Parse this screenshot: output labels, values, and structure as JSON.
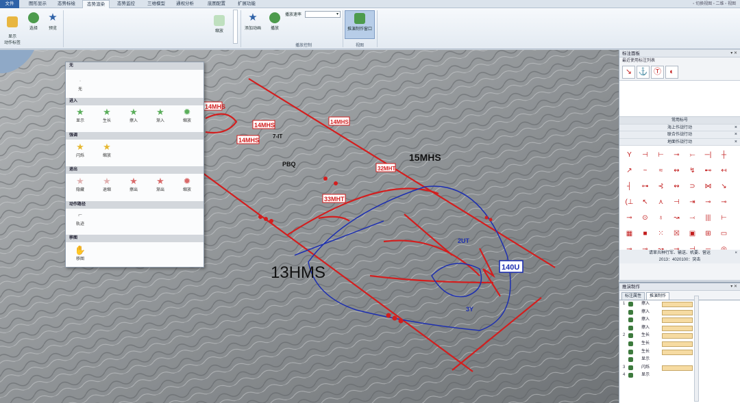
{
  "menubar": {
    "tabs": [
      {
        "label": "文件",
        "state": "file"
      },
      {
        "label": "图形显示",
        "state": ""
      },
      {
        "label": "态势标绘",
        "state": ""
      },
      {
        "label": "态势渲染",
        "state": "active"
      },
      {
        "label": "态势监控",
        "state": ""
      },
      {
        "label": "三维模型",
        "state": ""
      },
      {
        "label": "通视分析",
        "state": ""
      },
      {
        "label": "底图配置",
        "state": ""
      },
      {
        "label": "扩展功能",
        "state": ""
      }
    ],
    "window_controls": "▫ 切换视图 ▫ 二维 ▫ 视图"
  },
  "ribbon": {
    "show_label": "显示\n动作标签",
    "select": "选择",
    "preview": "预览",
    "zoom": "缩放",
    "add_anim": "添加动画",
    "play": "播放",
    "speed_label": "播放速率",
    "speed_value": "",
    "play_group": "播放控制",
    "make_window": "推演制作窗口",
    "view_group": "视图"
  },
  "dropdown": {
    "none_head": "无",
    "none_item": "无",
    "enter_head": "进入",
    "enter_items": [
      "显示",
      "生长",
      "擦入",
      "渐入",
      "缩放"
    ],
    "emph_head": "强调",
    "emph_items": [
      "闪烁",
      "缩放"
    ],
    "exit_head": "退出",
    "exit_items": [
      "隐藏",
      "退缩",
      "擦出",
      "渐出",
      "缩放"
    ],
    "path_head": "动作路径",
    "path_item": "轨迹",
    "move_head": "移图",
    "move_item": "移图"
  },
  "map_labels": {
    "l1": "14MHS",
    "l2": "14MHS",
    "l3": "14MHS",
    "l4": "14MHS",
    "l5": "15MHS",
    "l6": "32MHT",
    "l7": "33MHT",
    "l8": "13HMS",
    "l9": "140U",
    "l10": "3Y",
    "l11": "2UT",
    "l12": "PBQ",
    "l13": "7-IT"
  },
  "panel_top": {
    "title": "标注面板",
    "ctl": "▾ ✕",
    "recent": "最近使用标注列表",
    "recent_icons": [
      "↘",
      "⚓",
      "Ⓣ",
      "◐"
    ],
    "common": "常用标号",
    "cats": [
      "海上作战行动",
      "联合作战行动",
      "地面作战行动"
    ],
    "grid_symbols": [
      "Y",
      "⊣",
      "⊢",
      "⊸",
      "⤚",
      "─|",
      "┼",
      "↗",
      "~",
      "≈",
      "↭",
      "↯",
      "⊷",
      "↤",
      "┤",
      "⊶",
      "⊰",
      "↭",
      "⊃",
      "⋈",
      "↘",
      "(⊥",
      "↖",
      "⋏",
      "⊣",
      "⇥",
      "⊸",
      "⊸",
      "⊸",
      "⊙",
      "♁",
      "↝",
      "⤙",
      "|||",
      "⊢",
      "▦",
      "■",
      "⁙",
      "☒",
      "▣",
      "⊞",
      "▭",
      "⊸",
      "⊸",
      "↝",
      "⊸",
      "⊣",
      "─",
      "◎"
    ],
    "status": "请草兵种行军、输送、机要、营运",
    "coords": "2013：4020100：突击"
  },
  "panel_bottom": {
    "title": "推演制作",
    "tabs": [
      "标注属性",
      "推演制作"
    ],
    "rows": [
      {
        "n": "1",
        "lbl": "擦入",
        "bar": true
      },
      {
        "n": "",
        "lbl": "擦入",
        "bar": true
      },
      {
        "n": "",
        "lbl": "擦入",
        "bar": true
      },
      {
        "n": "",
        "lbl": "擦入",
        "bar": true
      },
      {
        "n": "2",
        "lbl": "生长",
        "bar": true
      },
      {
        "n": "",
        "lbl": "生长",
        "bar": true
      },
      {
        "n": "",
        "lbl": "生长",
        "bar": true
      },
      {
        "n": "",
        "lbl": "显示",
        "bar": false
      },
      {
        "n": "3",
        "lbl": "闪烁",
        "bar": true
      },
      {
        "n": "4",
        "lbl": "显示",
        "bar": false
      }
    ]
  }
}
